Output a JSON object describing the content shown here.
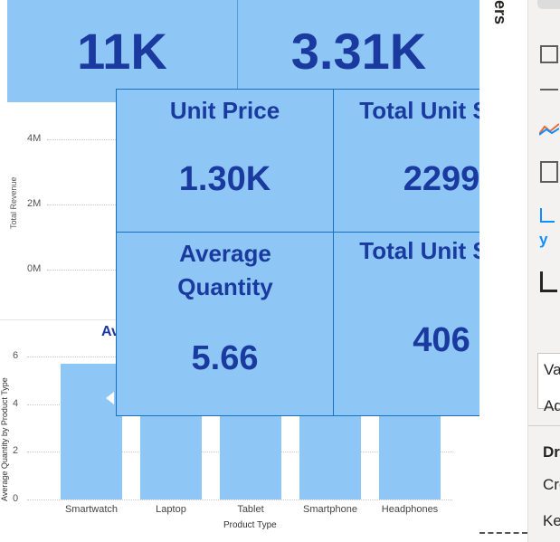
{
  "kpi_top": {
    "left_value": "11K",
    "right_value": "3.31K"
  },
  "revenue_chart": {
    "y_axis_title": "Total Revenue",
    "y_ticks": [
      "4M",
      "2M",
      "0M"
    ]
  },
  "card": {
    "unit_price_label": "Unit Price",
    "unit_price_value": "1.30K",
    "total_unit_sold_label_1": "Total Unit Sold",
    "total_unit_sold_value_1": "2299",
    "average_quantity_label": "Average Quantity",
    "average_quantity_value": "5.66",
    "total_unit_sold_label_2": "Total Unit Sold",
    "total_unit_sold_value_2": "406"
  },
  "chart_data": {
    "type": "bar",
    "title_visible_fragment": "Av",
    "xlabel": "Product Type",
    "ylabel": "Average Quantity by Product Type",
    "categories": [
      "Smartwatch",
      "Laptop",
      "Tablet",
      "Smartphone",
      "Headphones"
    ],
    "values": [
      5.7,
      5.7,
      5.7,
      5.7,
      5.7
    ],
    "y_ticks": [
      "6",
      "4",
      "2",
      "0"
    ],
    "ylim": [
      0,
      6
    ],
    "grid": true
  },
  "right_panel": {
    "vertical_heading": "ers",
    "labels": [
      "y",
      "Va",
      "Ad",
      "Dr",
      "Cro",
      "Ke"
    ]
  },
  "colors": {
    "card_bg": "#8ec6f5",
    "card_text": "#1a3aa0",
    "bar": "#8ec6f5"
  }
}
